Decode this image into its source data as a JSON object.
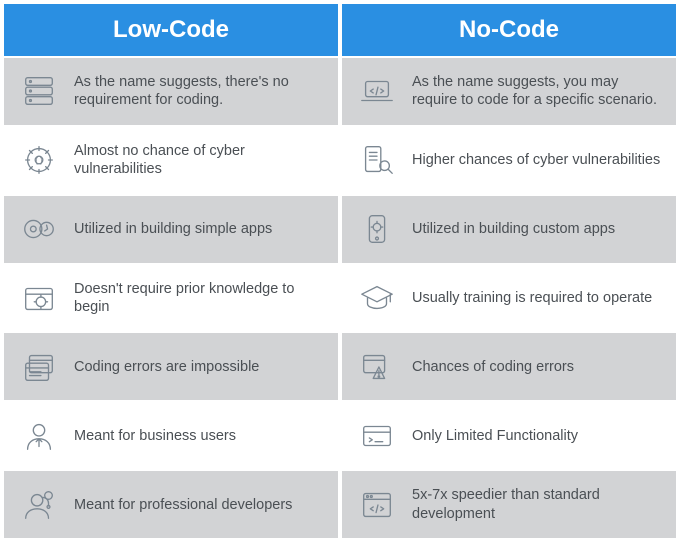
{
  "columns": [
    {
      "header": "Low-Code",
      "rows": [
        {
          "icon": "server-stack-icon",
          "text": "As the name suggests, there's no requirement for coding."
        },
        {
          "icon": "gear-braces-icon",
          "text": "Almost no chance of cyber vulnerabilities"
        },
        {
          "icon": "gear-shield-icon",
          "text": "Utilized in building simple apps"
        },
        {
          "icon": "gear-window-icon",
          "text": "Doesn't require prior knowledge to begin"
        },
        {
          "icon": "windows-stack-icon",
          "text": "Coding errors are impossible"
        },
        {
          "icon": "user-business-icon",
          "text": "Meant for business users"
        },
        {
          "icon": "user-headset-icon",
          "text": "Meant for professional developers"
        }
      ]
    },
    {
      "header": "No-Code",
      "rows": [
        {
          "icon": "laptop-code-icon",
          "text": "As the name suggests, you may require to code for a specific scenario."
        },
        {
          "icon": "device-search-icon",
          "text": "Higher chances of cyber vulnerabilities"
        },
        {
          "icon": "phone-gear-icon",
          "text": "Utilized in building custom apps"
        },
        {
          "icon": "grad-cap-icon",
          "text": "Usually training is required to operate"
        },
        {
          "icon": "window-warning-icon",
          "text": "Chances of coding errors"
        },
        {
          "icon": "terminal-window-icon",
          "text": "Only Limited Functionality"
        },
        {
          "icon": "browser-code-icon",
          "text": "5x-7x speedier than standard development"
        }
      ]
    }
  ]
}
